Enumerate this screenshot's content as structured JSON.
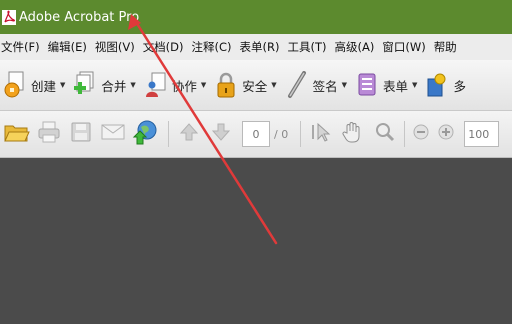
{
  "app": {
    "title": "Adobe Acrobat Pro"
  },
  "menu": {
    "items": [
      {
        "key": "file",
        "label": "文件(F)"
      },
      {
        "key": "edit",
        "label": "编辑(E)"
      },
      {
        "key": "view",
        "label": "视图(V)"
      },
      {
        "key": "document",
        "label": "文档(D)"
      },
      {
        "key": "comments",
        "label": "注释(C)"
      },
      {
        "key": "forms",
        "label": "表单(R)"
      },
      {
        "key": "tools",
        "label": "工具(T)"
      },
      {
        "key": "advanced",
        "label": "高级(A)"
      },
      {
        "key": "window",
        "label": "窗口(W)"
      },
      {
        "key": "help",
        "label": "帮助"
      }
    ]
  },
  "toolbar": {
    "create": "创建",
    "combine": "合并",
    "collaborate": "协作",
    "secure": "安全",
    "sign": "签名",
    "forms": "表单",
    "multimedia": "多"
  },
  "navigation": {
    "current_page": "0",
    "total_pages": "/ 0",
    "zoom": "100"
  },
  "colors": {
    "titlebar": "#5c8a2e",
    "annotation_arrow": "#e03a3a"
  },
  "icons": [
    "acrobat-logo-icon",
    "create-pdf-icon",
    "combine-icon",
    "collaborate-icon",
    "lock-icon",
    "pen-icon",
    "form-icon",
    "multimedia-icon",
    "open-folder-icon",
    "print-icon",
    "save-icon",
    "email-icon",
    "globe-icon",
    "previous-page-icon",
    "next-page-icon",
    "select-tool-icon",
    "hand-icon",
    "zoom-tool-icon",
    "zoom-out-icon",
    "zoom-in-icon"
  ]
}
